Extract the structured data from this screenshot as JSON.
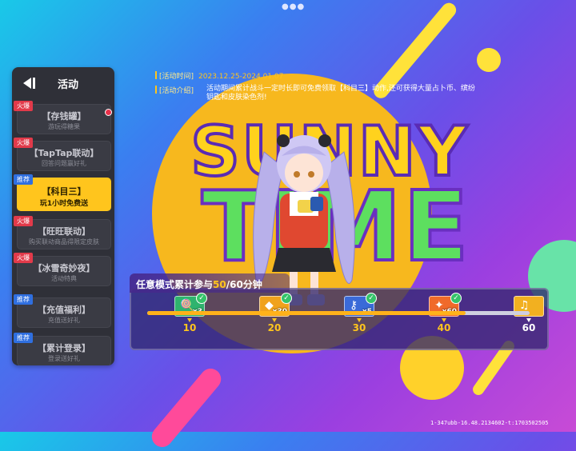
{
  "sidebar": {
    "title": "活动",
    "items": [
      {
        "tag": "火爆",
        "tag_type": "hot",
        "name": "【存钱罐】",
        "sub": "游玩得糖果",
        "active": false
      },
      {
        "tag": "火爆",
        "tag_type": "hot",
        "name": "【TapTap联动】",
        "sub": "回答问题赢好礼",
        "active": false
      },
      {
        "tag": "推荐",
        "tag_type": "rec",
        "name": "【科目三】",
        "sub": "玩1小时免费送",
        "active": true
      },
      {
        "tag": "火爆",
        "tag_type": "hot",
        "name": "【旺旺联动】",
        "sub": "购买联动商品得限定皮肤",
        "active": false
      },
      {
        "tag": "火爆",
        "tag_type": "hot",
        "name": "【冰雪奇妙夜】",
        "sub": "活动特典",
        "active": false
      },
      {
        "tag": "推荐",
        "tag_type": "rec",
        "name": "【充值福利】",
        "sub": "充值送好礼",
        "active": false
      },
      {
        "tag": "推荐",
        "tag_type": "rec",
        "name": "【累计登录】",
        "sub": "登录送好礼",
        "active": false
      }
    ]
  },
  "info": {
    "time_label": "[活动时间]",
    "time_value": "2023.12.25-2024.01.07",
    "intro_label": "[活动介绍]",
    "intro_value": "活动期间累计战斗一定时长即可免费领取【科目三】动作,还可获得大量占卜币、缤纷钥匙和皮肤染色剂!"
  },
  "logo": {
    "top": "SUNNY",
    "bottom": "TIME"
  },
  "progress": {
    "title_prefix": "任意模式累计参与",
    "current": "50",
    "suffix": "/60分钟",
    "value": 50,
    "max": 60,
    "ticks": [
      "10",
      "20",
      "30",
      "40",
      "60"
    ],
    "rewards": [
      {
        "qty": "x3",
        "icon": "candy-icon",
        "claimed": true
      },
      {
        "qty": "x30",
        "icon": "coin-icon",
        "claimed": true
      },
      {
        "qty": "x5",
        "icon": "key-icon",
        "claimed": true
      },
      {
        "qty": "x60",
        "icon": "dye-icon",
        "claimed": true
      },
      {
        "qty": "",
        "icon": "dance-icon",
        "claimed": false
      }
    ]
  },
  "footer_id": "1-347ubb-16.48.2134602-t:1703502505",
  "colors": {
    "accent": "#ffc51d",
    "hot": "#e23a4a",
    "rec": "#2f6fe0"
  }
}
